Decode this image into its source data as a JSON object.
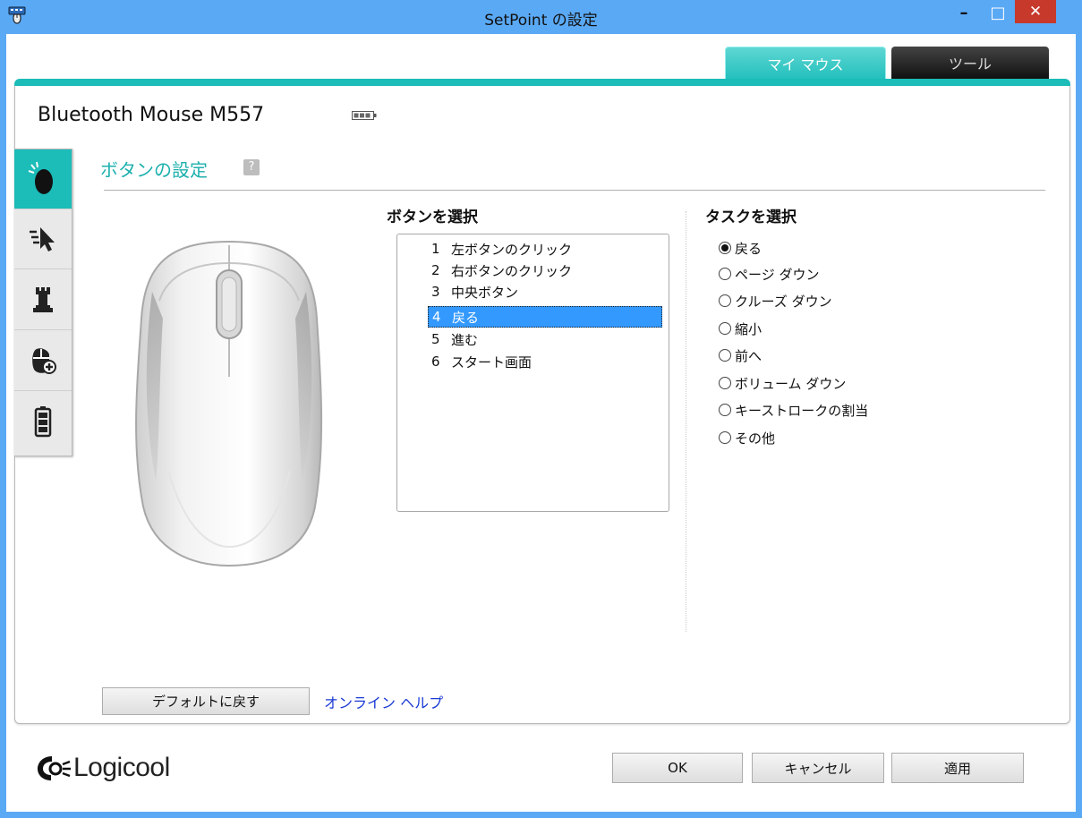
{
  "window": {
    "title": "SetPoint の設定",
    "minimize": "–",
    "maximize": "□",
    "close": "✕"
  },
  "tabs": [
    {
      "label": "マイ マウス",
      "active": true
    },
    {
      "label": "ツール",
      "active": false
    }
  ],
  "device": {
    "name": "Bluetooth Mouse M557"
  },
  "sidebar": {
    "items": [
      {
        "icon": "mouse-button-icon",
        "active": true
      },
      {
        "icon": "pointer-speed-icon",
        "active": false
      },
      {
        "icon": "game-rook-icon",
        "active": false
      },
      {
        "icon": "mouse-add-icon",
        "active": false
      },
      {
        "icon": "battery-icon",
        "active": false
      }
    ]
  },
  "section": {
    "title": "ボタンの設定",
    "help": "?"
  },
  "buttons": {
    "heading": "ボタンを選択",
    "items": [
      {
        "num": "1",
        "label": "左ボタンのクリック"
      },
      {
        "num": "2",
        "label": "右ボタンのクリック"
      },
      {
        "num": "3",
        "label": "中央ボタン"
      },
      {
        "num": "4",
        "label": "戻る",
        "selected": true
      },
      {
        "num": "5",
        "label": "進む"
      },
      {
        "num": "6",
        "label": "スタート画面"
      }
    ]
  },
  "tasks": {
    "heading": "タスクを選択",
    "options": [
      {
        "label": "戻る",
        "checked": true
      },
      {
        "label": "ページ ダウン",
        "checked": false
      },
      {
        "label": "クルーズ ダウン",
        "checked": false
      },
      {
        "label": "縮小",
        "checked": false
      },
      {
        "label": "前へ",
        "checked": false
      },
      {
        "label": "ボリューム ダウン",
        "checked": false
      },
      {
        "label": "キーストロークの割当",
        "checked": false
      },
      {
        "label": "その他",
        "checked": false
      }
    ]
  },
  "footer": {
    "restore_default": "デフォルトに戻す",
    "online_help": "オンライン ヘルプ",
    "ok": "OK",
    "cancel": "キャンセル",
    "apply": "適用"
  },
  "brand": {
    "name": "Logicool"
  },
  "colors": {
    "accent": "#1cbcb8",
    "titlebar": "#5aa9f5",
    "selection": "#3399ff",
    "link": "#1a3bd4"
  }
}
